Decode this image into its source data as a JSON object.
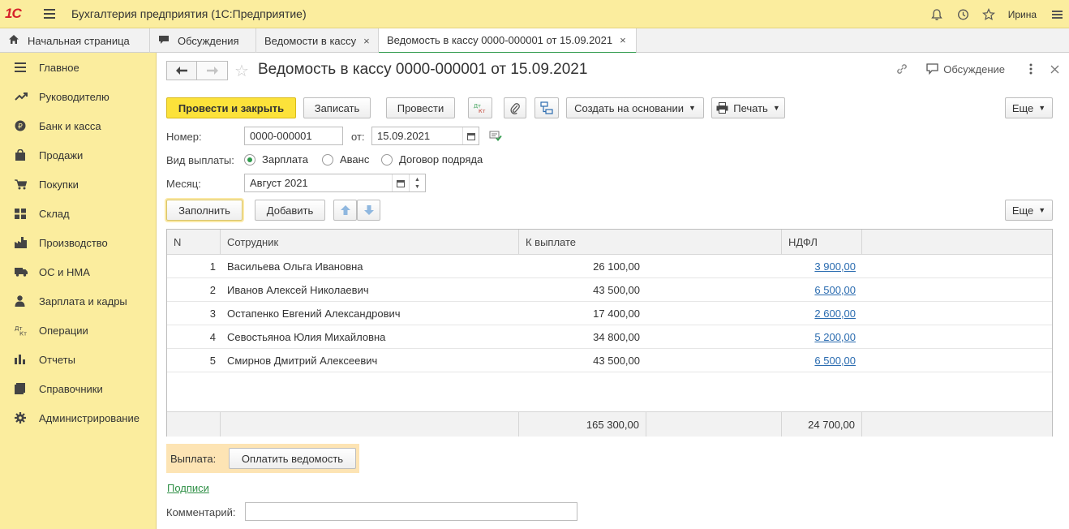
{
  "app": {
    "logo": "1С",
    "title": "Бухгалтерия предприятия (1С:Предприятие)",
    "user": "Ирина"
  },
  "tabs": [
    {
      "label": "Начальная страница"
    },
    {
      "label": "Обсуждения"
    },
    {
      "label": "Ведомости в кассу",
      "close": "×"
    },
    {
      "label": "Ведомость в кассу 0000-000001 от 15.09.2021",
      "close": "×"
    }
  ],
  "sidebar": {
    "items": [
      {
        "label": "Главное",
        "icon": "menu-icon"
      },
      {
        "label": "Руководителю",
        "icon": "trend-icon"
      },
      {
        "label": "Банк и касса",
        "icon": "ruble-icon"
      },
      {
        "label": "Продажи",
        "icon": "bag-icon"
      },
      {
        "label": "Покупки",
        "icon": "cart-icon"
      },
      {
        "label": "Склад",
        "icon": "grid-icon"
      },
      {
        "label": "Производство",
        "icon": "factory-icon"
      },
      {
        "label": "ОС и НМА",
        "icon": "truck-icon"
      },
      {
        "label": "Зарплата и кадры",
        "icon": "person-icon"
      },
      {
        "label": "Операции",
        "icon": "dt-kt-icon"
      },
      {
        "label": "Отчеты",
        "icon": "bar-chart-icon"
      },
      {
        "label": "Справочники",
        "icon": "books-icon"
      },
      {
        "label": "Администрирование",
        "icon": "gear-icon"
      }
    ]
  },
  "document": {
    "title": "Ведомость в кассу 0000-000001 от 15.09.2021",
    "discussion": "Обсуждение"
  },
  "toolbar": {
    "post_close": "Провести и закрыть",
    "save": "Записать",
    "post": "Провести",
    "dt_kt": "Дт Кт",
    "create_based": "Создать на основании",
    "print": "Печать",
    "more": "Еще"
  },
  "form": {
    "number_label": "Номер:",
    "number": "0000-000001",
    "date_label": "от:",
    "date": "15.09.2021",
    "payment_type_label": "Вид выплаты:",
    "payment_types": [
      "Зарплата",
      "Аванс",
      "Договор подряда"
    ],
    "payment_type_selected": 0,
    "month_label": "Месяц:",
    "month": "Август 2021"
  },
  "table_toolbar": {
    "fill": "Заполнить",
    "add": "Добавить",
    "more": "Еще"
  },
  "table": {
    "columns": [
      "N",
      "Сотрудник",
      "К выплате",
      "НДФЛ"
    ],
    "rows": [
      {
        "n": "1",
        "employee": "Васильева Ольга Ивановна",
        "to_pay": "26 100,00",
        "ndfl": "3 900,00"
      },
      {
        "n": "2",
        "employee": "Иванов Алексей Николаевич",
        "to_pay": "43 500,00",
        "ndfl": "6 500,00"
      },
      {
        "n": "3",
        "employee": "Остапенко Евгений Александрович",
        "to_pay": "17 400,00",
        "ndfl": "2 600,00"
      },
      {
        "n": "4",
        "employee": "Севостьяноа Юлия Михайловна",
        "to_pay": "34 800,00",
        "ndfl": "5 200,00"
      },
      {
        "n": "5",
        "employee": "Смирнов Дмитрий Алексеевич",
        "to_pay": "43 500,00",
        "ndfl": "6 500,00"
      }
    ],
    "total_to_pay": "165 300,00",
    "total_ndfl": "24 700,00"
  },
  "payment": {
    "label": "Выплата:",
    "button": "Оплатить ведомость"
  },
  "signatures_link": "Подписи",
  "comment_label": "Комментарий:",
  "comment": ""
}
